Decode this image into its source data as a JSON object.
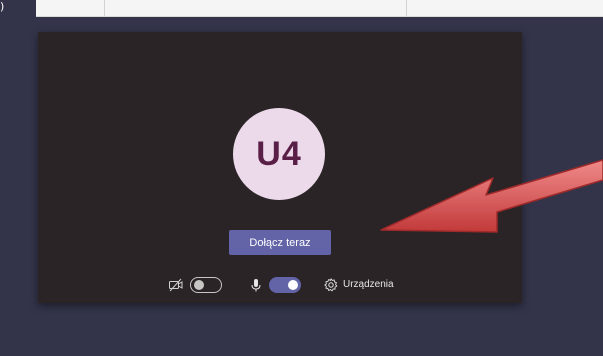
{
  "top": {
    "corner_glyph": ")"
  },
  "preview": {
    "avatar_initials": "U4",
    "join_button_label": "Dołącz teraz",
    "devices_label": "Urządzenia"
  },
  "controls": {
    "camera_on": false,
    "microphone_on": true
  },
  "colors": {
    "background": "#33344a",
    "preview_bg": "#2a2427",
    "avatar_bg": "#ecd9ea",
    "avatar_text": "#5a1f47",
    "accent": "#6264a7",
    "annotation_arrow": "#d64b4b"
  },
  "icons": [
    "camera-off-icon",
    "microphone-icon",
    "gear-icon"
  ]
}
